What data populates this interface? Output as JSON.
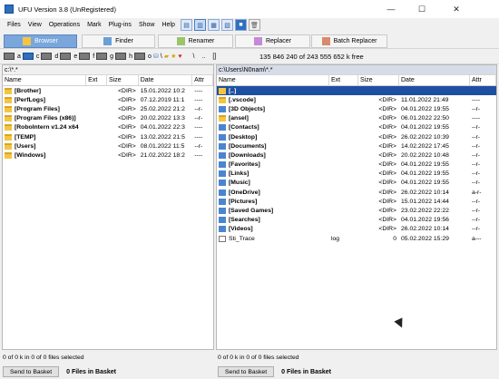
{
  "window": {
    "title": "UFU Version 3.8 (UnRegistered)",
    "minimize_glyph": "—",
    "maximize_glyph": "☐",
    "close_glyph": "✕"
  },
  "menu": [
    "Files",
    "View",
    "Operations",
    "Mark",
    "Plug-ins",
    "Show",
    "Help"
  ],
  "tabs": [
    "Browser",
    "Finder",
    "Renamer",
    "Replacer",
    "Batch Replacer"
  ],
  "drives": [
    "a",
    "c",
    "d",
    "e",
    "f",
    "g",
    "h",
    "o"
  ],
  "drivebar": {
    "separator1": "\\",
    "separator2": "..",
    "separator3": "[]",
    "free_text": "135 846 240 of 243 555 652 k free"
  },
  "left_panel": {
    "path": "c:\\*.*",
    "columns": [
      "Name",
      "Ext",
      "Size",
      "Date",
      "Attr"
    ],
    "rows": [
      {
        "name": "[Brother]",
        "ext": "",
        "size": "<DIR>",
        "date": "15.01.2022 10:2",
        "attr": "----"
      },
      {
        "name": "[PerfLogs]",
        "ext": "",
        "size": "<DIR>",
        "date": "07.12.2019 11:1",
        "attr": "----"
      },
      {
        "name": "[Program Files]",
        "ext": "",
        "size": "<DIR>",
        "date": "25.02.2022 21:2",
        "attr": "--r-"
      },
      {
        "name": "[Program Files (x86)]",
        "ext": "",
        "size": "<DIR>",
        "date": "20.02.2022 13:3",
        "attr": "--r-"
      },
      {
        "name": "[RoboIntern v1.24 x64",
        "ext": "",
        "size": "<DIR>",
        "date": "04.01.2022 22:3",
        "attr": "----"
      },
      {
        "name": "[TEMP]",
        "ext": "",
        "size": "<DIR>",
        "date": "13.02.2022 21:5",
        "attr": "----"
      },
      {
        "name": "[Users]",
        "ext": "",
        "size": "<DIR>",
        "date": "08.01.2022 11:5",
        "attr": "--r-"
      },
      {
        "name": "[Windows]",
        "ext": "",
        "size": "<DIR>",
        "date": "21.02.2022 18:2",
        "attr": "----"
      }
    ],
    "status": "0 of 0 k in 0 of 0 files selected",
    "send_button": "Send to Basket",
    "basket": "0 Files in Basket"
  },
  "right_panel": {
    "path": "c:\\Users\\N0nam\\*.*",
    "columns": [
      "Name",
      "Ext",
      "Size",
      "Date",
      "Attr"
    ],
    "rows": [
      {
        "name": "[..]",
        "ext": "",
        "size": "",
        "date": "",
        "attr": "",
        "icon": "up"
      },
      {
        "name": "[.vscode]",
        "ext": "",
        "size": "<DIR>",
        "date": "11.01.2022 21:49",
        "attr": "----",
        "icon": "folder"
      },
      {
        "name": "[3D Objects]",
        "ext": "",
        "size": "<DIR>",
        "date": "04.01.2022 19:55",
        "attr": "--r-",
        "icon": "special"
      },
      {
        "name": "[ansel]",
        "ext": "",
        "size": "<DIR>",
        "date": "06.01.2022 22:50",
        "attr": "----",
        "icon": "folder"
      },
      {
        "name": "[Contacts]",
        "ext": "",
        "size": "<DIR>",
        "date": "04.01.2022 19:55",
        "attr": "--r-",
        "icon": "special"
      },
      {
        "name": "[Desktop]",
        "ext": "",
        "size": "<DIR>",
        "date": "26.02.2022 10:39",
        "attr": "--r-",
        "icon": "special"
      },
      {
        "name": "[Documents]",
        "ext": "",
        "size": "<DIR>",
        "date": "14.02.2022 17:45",
        "attr": "--r-",
        "icon": "special"
      },
      {
        "name": "[Downloads]",
        "ext": "",
        "size": "<DIR>",
        "date": "20.02.2022 10:48",
        "attr": "--r-",
        "icon": "special"
      },
      {
        "name": "[Favorites]",
        "ext": "",
        "size": "<DIR>",
        "date": "04.01.2022 19:55",
        "attr": "--r-",
        "icon": "special"
      },
      {
        "name": "[Links]",
        "ext": "",
        "size": "<DIR>",
        "date": "04.01.2022 19:55",
        "attr": "--r-",
        "icon": "special"
      },
      {
        "name": "[Music]",
        "ext": "",
        "size": "<DIR>",
        "date": "04.01.2022 19:55",
        "attr": "--r-",
        "icon": "special"
      },
      {
        "name": "[OneDrive]",
        "ext": "",
        "size": "<DIR>",
        "date": "26.02.2022 10:14",
        "attr": "a-r-",
        "icon": "special"
      },
      {
        "name": "[Pictures]",
        "ext": "",
        "size": "<DIR>",
        "date": "15.01.2022 14:44",
        "attr": "--r-",
        "icon": "special"
      },
      {
        "name": "[Saved Games]",
        "ext": "",
        "size": "<DIR>",
        "date": "23.02.2022 22:22",
        "attr": "--r-",
        "icon": "special"
      },
      {
        "name": "[Searches]",
        "ext": "",
        "size": "<DIR>",
        "date": "04.01.2022 19:56",
        "attr": "--r-",
        "icon": "special"
      },
      {
        "name": "[Videos]",
        "ext": "",
        "size": "<DIR>",
        "date": "26.02.2022 10:14",
        "attr": "--r-",
        "icon": "special"
      },
      {
        "name": "Sti_Trace",
        "ext": "log",
        "size": "0",
        "date": "05.02.2022 15:29",
        "attr": "a---",
        "icon": "doc"
      }
    ],
    "status": "0 of 0 k in 0 of 0 files selected",
    "send_button": "Send to Basket",
    "basket": "0 Files in Basket"
  }
}
